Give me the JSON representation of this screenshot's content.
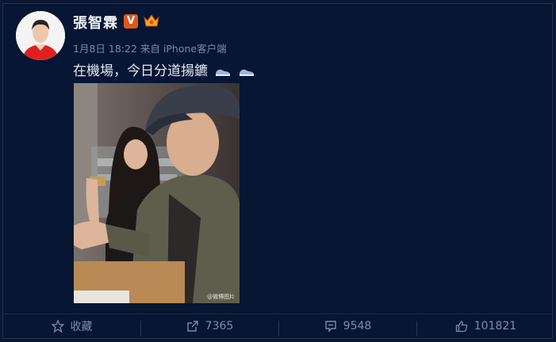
{
  "post": {
    "username": "張智霖",
    "verified_badge": "V",
    "time": "1月8日 18:22",
    "source_prefix": "来自",
    "source": "iPhone客户端",
    "text": "在機場，今日分道揚鑣"
  },
  "photo": {
    "watermark": "@微博图片"
  },
  "actions": {
    "favorite": {
      "label": "收藏",
      "icon": "star-icon"
    },
    "repost": {
      "count": "7365",
      "icon": "share-icon"
    },
    "comment": {
      "count": "9548",
      "icon": "comment-icon"
    },
    "like": {
      "count": "101821",
      "icon": "thumbs-up-icon"
    }
  },
  "colors": {
    "background": "#061633",
    "username": "#f1f4fa",
    "meta": "#7b8aa8",
    "verified": "#e0571c"
  }
}
